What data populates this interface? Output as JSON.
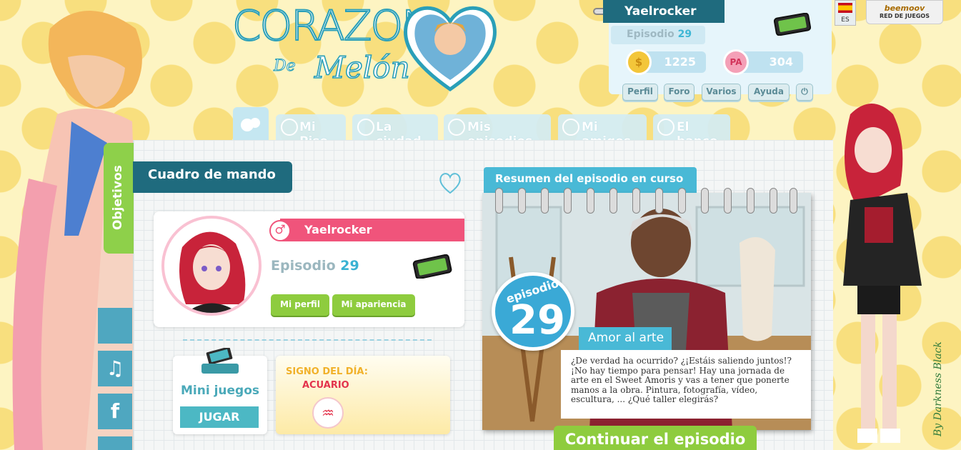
{
  "colors": {
    "dark_teal": "#1f6b7e",
    "light_blue": "#49b9d6",
    "pink": "#f0547b",
    "green": "#8ecc3e",
    "yellow_bg": "#fdf4c2"
  },
  "logo": {
    "line1": "CORAZON",
    "line2_a": "De",
    "line2_b": "Melón"
  },
  "user_panel": {
    "username": "Yaelrocker",
    "episode_label": "Episodio",
    "episode_number": "29",
    "coins": "1225",
    "coins_icon_symbol": "$",
    "pa_points": "304",
    "pa_icon_symbol": "PA",
    "menu": [
      "Perfil",
      "Foro",
      "Varios",
      "Ayuda"
    ],
    "power_icon": "⏻"
  },
  "language": {
    "code": "ES"
  },
  "beemoov": {
    "brand": "beemoov",
    "tagline": "RED DE JUEGOS"
  },
  "nav": {
    "tabs": [
      "Mi Piso",
      "La ciudad",
      "Mis episodios",
      "Mi amigos",
      "El banco"
    ]
  },
  "sidebar": {
    "objetivos": "Objetivos",
    "social": [
      "",
      "♫",
      "f"
    ]
  },
  "dashboard": {
    "title": "Cuadro de mando",
    "gender_symbol": "♂",
    "card_username": "Yaelrocker",
    "card_episode_label": "Episodio",
    "card_episode_number": "29",
    "buttons": [
      "Mi perfil",
      "Mi apariencia"
    ]
  },
  "mini_games": {
    "title": "Mini juegos",
    "button": "JUGAR"
  },
  "sign": {
    "label": "SIGNO DEL DÍA:",
    "value": "ACUARIO",
    "symbol": "♒"
  },
  "episode_summary": {
    "title": "Resumen del episodio en curso",
    "badge_label": "episodio",
    "badge_number": "29",
    "episode_title": "Amor al arte",
    "description": "¿De verdad ha ocurrido? ¿¡Estáis saliendo juntos!? ¡No hay tiempo para pensar! Hay una jornada de arte en el Sweet Amoris y vas a tener que ponerte manos a la obra. Pintura, fotografía, vídeo, escultura, ... ¿Qué taller elegirás?",
    "continue_button": "Continuar el episodio"
  },
  "signature": "By Darkness Black"
}
